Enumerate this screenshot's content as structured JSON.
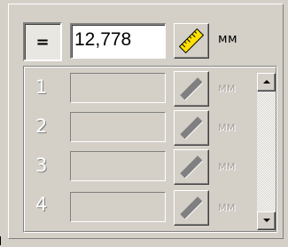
{
  "main": {
    "equals_label": "=",
    "value": "12,778",
    "unit": "мм"
  },
  "rows": [
    {
      "index": "1",
      "value": "",
      "unit": "мм"
    },
    {
      "index": "2",
      "value": "",
      "unit": "мм"
    },
    {
      "index": "3",
      "value": "",
      "unit": "мм"
    },
    {
      "index": "4",
      "value": "",
      "unit": "мм"
    }
  ],
  "icons": {
    "ruler_active": "ruler-icon",
    "ruler_disabled": "ruler-icon",
    "scroll_up": "arrow-up-icon",
    "scroll_down": "arrow-down-icon"
  },
  "colors": {
    "ruler_yellow": "#ffe000",
    "disabled_gray": "#a6a29a"
  }
}
